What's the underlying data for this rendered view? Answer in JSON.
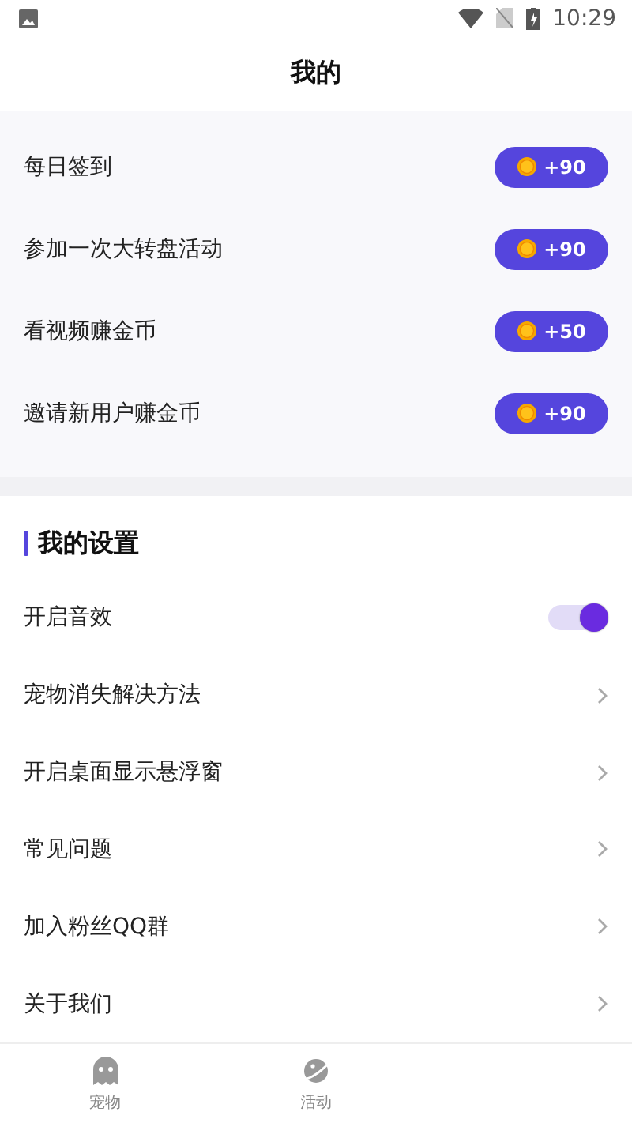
{
  "status_bar": {
    "time": "10:29"
  },
  "title": "我的",
  "tasks": [
    {
      "label": "每日签到",
      "reward": "+90"
    },
    {
      "label": "参加一次大转盘活动",
      "reward": "+90"
    },
    {
      "label": "看视频赚金币",
      "reward": "+50"
    },
    {
      "label": "邀请新用户赚金币",
      "reward": "+90"
    }
  ],
  "settings": {
    "title": "我的设置",
    "items": [
      {
        "kind": "toggle",
        "label": "开启音效",
        "on": true
      },
      {
        "kind": "link",
        "label": "宠物消失解决方法"
      },
      {
        "kind": "link",
        "label": "开启桌面显示悬浮窗"
      },
      {
        "kind": "link",
        "label": "常见问题"
      },
      {
        "kind": "link",
        "label": "加入粉丝QQ群"
      },
      {
        "kind": "link",
        "label": "关于我们"
      }
    ]
  },
  "tab_bar": [
    {
      "label": "宠物",
      "selected": false
    },
    {
      "label": "活动",
      "selected": false
    }
  ]
}
